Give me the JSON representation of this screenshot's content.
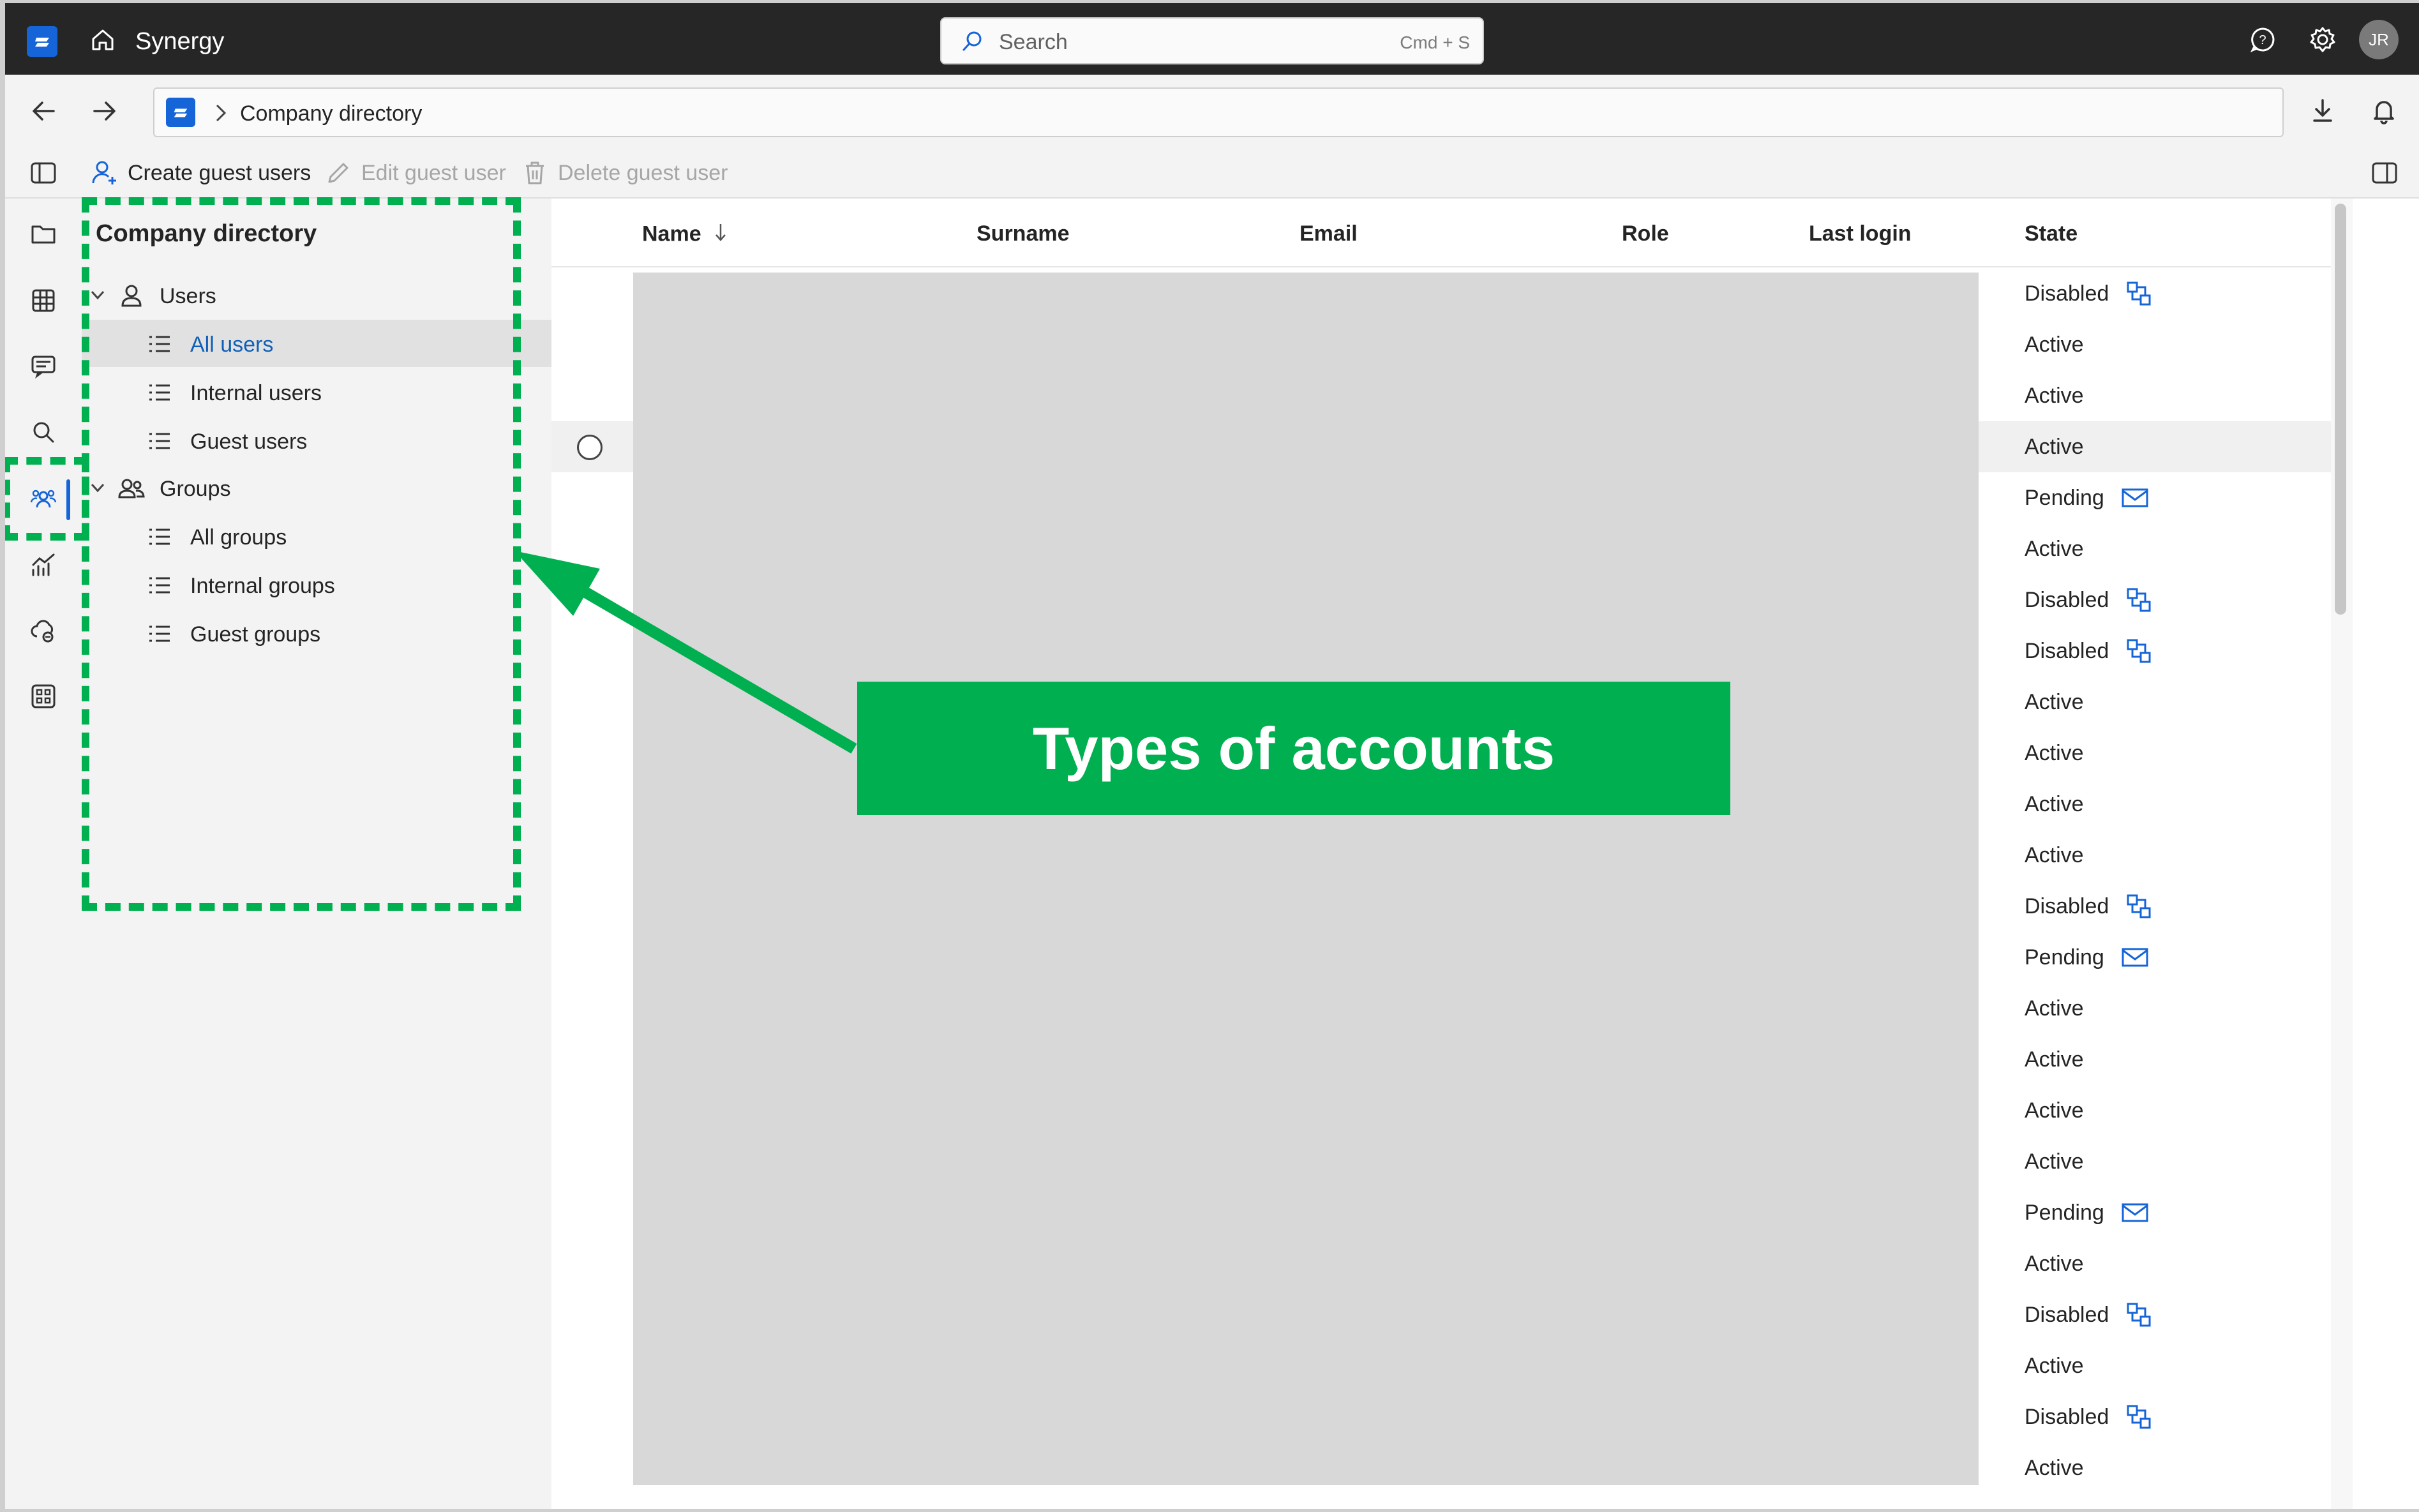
{
  "app": {
    "name": "Synergy",
    "user_initials": "JR"
  },
  "search": {
    "placeholder": "Search",
    "shortcut": "Cmd + S"
  },
  "breadcrumb": {
    "current": "Company directory"
  },
  "toolbar": {
    "create_label": "Create guest users",
    "edit_label": "Edit guest user",
    "delete_label": "Delete guest user"
  },
  "nav": {
    "title": "Company directory",
    "users": {
      "label": "Users",
      "items": [
        "All users",
        "Internal users",
        "Guest users"
      ]
    },
    "groups": {
      "label": "Groups",
      "items": [
        "All groups",
        "Internal groups",
        "Guest groups"
      ]
    },
    "selected_item": "All users"
  },
  "table": {
    "columns": [
      "Name",
      "Surname",
      "Email",
      "Role",
      "Last login",
      "State"
    ],
    "sort": {
      "column": "Name",
      "direction": "descending"
    },
    "states": [
      {
        "state": "Disabled",
        "icon": "sync-icon"
      },
      {
        "state": "Active",
        "icon": ""
      },
      {
        "state": "Active",
        "icon": ""
      },
      {
        "state": "Active",
        "icon": ""
      },
      {
        "state": "Pending",
        "icon": "mail-icon"
      },
      {
        "state": "Active",
        "icon": ""
      },
      {
        "state": "Disabled",
        "icon": "sync-icon"
      },
      {
        "state": "Disabled",
        "icon": "sync-icon"
      },
      {
        "state": "Active",
        "icon": ""
      },
      {
        "state": "Active",
        "icon": ""
      },
      {
        "state": "Active",
        "icon": ""
      },
      {
        "state": "Active",
        "icon": ""
      },
      {
        "state": "Disabled",
        "icon": "sync-icon"
      },
      {
        "state": "Pending",
        "icon": "mail-icon"
      },
      {
        "state": "Active",
        "icon": ""
      },
      {
        "state": "Active",
        "icon": ""
      },
      {
        "state": "Active",
        "icon": ""
      },
      {
        "state": "Active",
        "icon": ""
      },
      {
        "state": "Pending",
        "icon": "mail-icon"
      },
      {
        "state": "Active",
        "icon": ""
      },
      {
        "state": "Disabled",
        "icon": "sync-icon"
      },
      {
        "state": "Active",
        "icon": ""
      },
      {
        "state": "Disabled",
        "icon": "sync-icon"
      },
      {
        "state": "Active",
        "icon": ""
      }
    ]
  },
  "annotation": {
    "callout_text": "Types of accounts",
    "color": "#00b050"
  },
  "colors": {
    "accent": "#1565d8",
    "titlebar": "#262626"
  }
}
